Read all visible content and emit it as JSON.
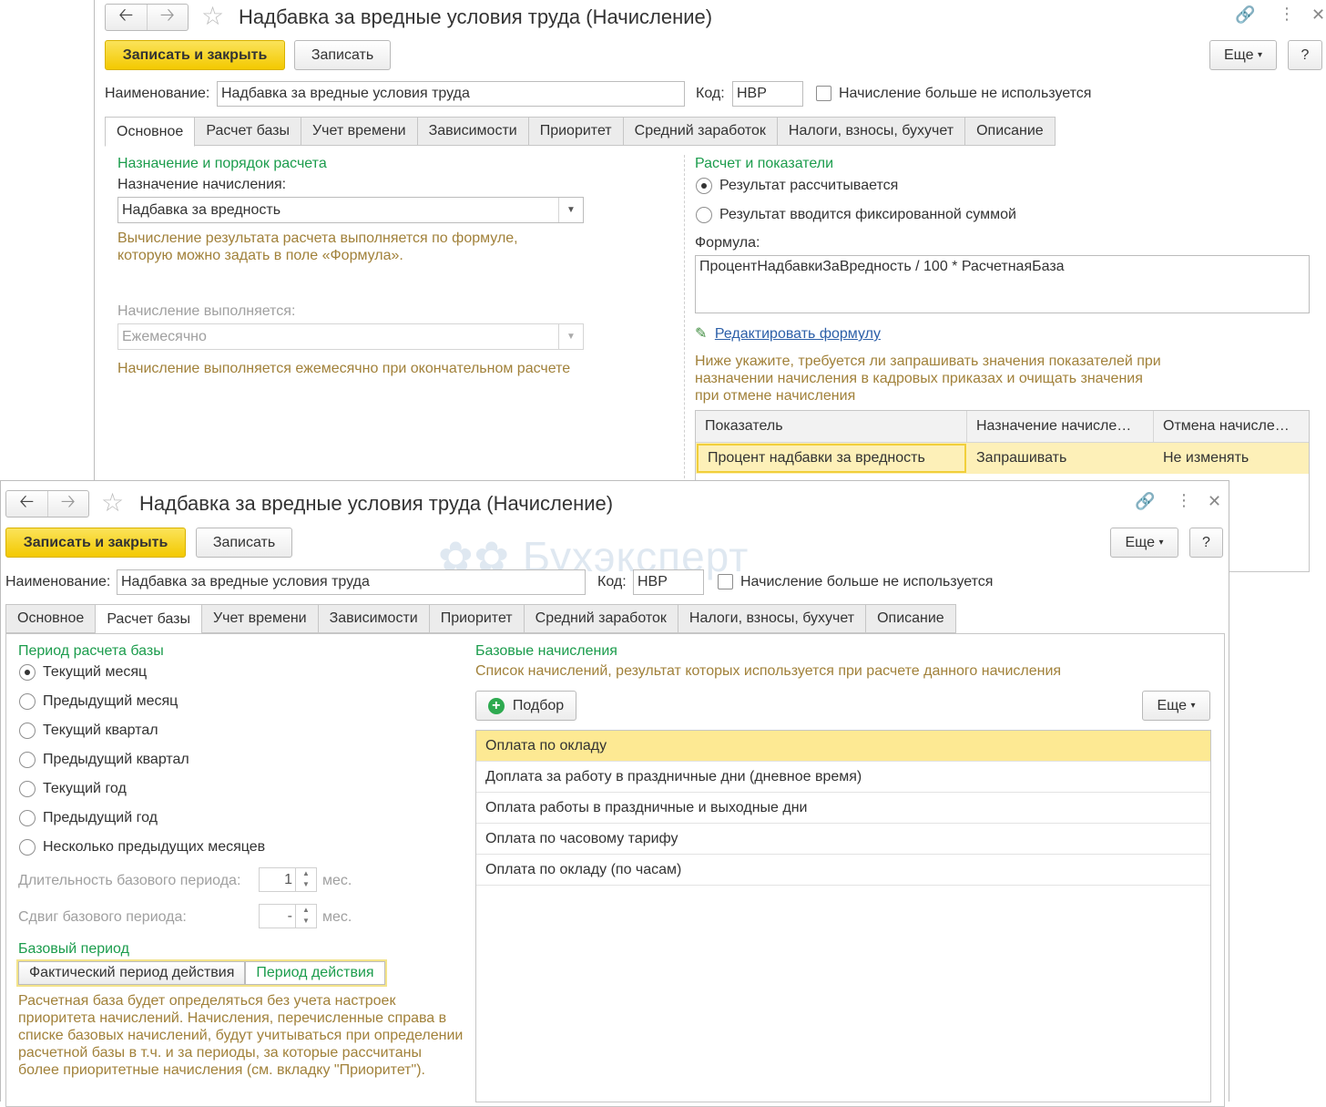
{
  "back_window": {
    "title": "Надбавка за вредные условия труда (Начисление)",
    "btn_save_close": "Записать и закрыть",
    "btn_save": "Записать",
    "btn_more": "Еще",
    "btn_help": "?",
    "name_label": "Наименование:",
    "name_value": "Надбавка за вредные условия труда",
    "code_label": "Код:",
    "code_value": "НВР",
    "unused_label": "Начисление больше не используется",
    "tabs": [
      "Основное",
      "Расчет базы",
      "Учет времени",
      "Зависимости",
      "Приоритет",
      "Средний заработок",
      "Налоги, взносы, бухучет",
      "Описание"
    ],
    "left": {
      "section": "Назначение и порядок расчета",
      "purpose_label": "Назначение начисления:",
      "purpose_value": "Надбавка за вредность",
      "purpose_hint": "Вычисление результата расчета выполняется по формуле, которую можно задать в поле «Формула».",
      "exec_label": "Начисление выполняется:",
      "exec_value": "Ежемесячно",
      "exec_hint": "Начисление выполняется ежемесячно при окончательном расчете"
    },
    "right": {
      "section": "Расчет и показатели",
      "radio_calc": "Результат рассчитывается",
      "radio_fixed": "Результат вводится фиксированной суммой",
      "formula_label": "Формула:",
      "formula_value": "ПроцентНадбавкиЗаВредность / 100 * РасчетнаяБаза",
      "edit_link": "Редактировать формулу",
      "indicators_hint": "Ниже укажите, требуется ли запрашивать значения показателей при назначении начисления в кадровых приказах и очищать значения при отмене начисления",
      "grid_headers": [
        "Показатель",
        "Назначение начисле…",
        "Отмена начисле…"
      ],
      "grid_row": [
        "Процент надбавки за вредность",
        "Запрашивать",
        "Не изменять"
      ]
    }
  },
  "front_window": {
    "title": "Надбавка за вредные условия труда (Начисление)",
    "btn_save_close": "Записать и закрыть",
    "btn_save": "Записать",
    "btn_more": "Еще",
    "btn_help": "?",
    "watermark": "Бухэксперт",
    "name_label": "Наименование:",
    "name_value": "Надбавка за вредные условия труда",
    "code_label": "Код:",
    "code_value": "НВР",
    "unused_label": "Начисление больше не используется",
    "tabs": [
      "Основное",
      "Расчет базы",
      "Учет времени",
      "Зависимости",
      "Приоритет",
      "Средний заработок",
      "Налоги, взносы, бухучет",
      "Описание"
    ],
    "left": {
      "section": "Период расчета базы",
      "periods": [
        "Текущий месяц",
        "Предыдущий месяц",
        "Текущий квартал",
        "Предыдущий квартал",
        "Текущий год",
        "Предыдущий год",
        "Несколько предыдущих месяцев"
      ],
      "duration_label": "Длительность базового периода:",
      "duration_value": "1",
      "duration_unit": "мес.",
      "shift_label": "Сдвиг базового периода:",
      "shift_value": "-",
      "shift_unit": "мес.",
      "base_section": "Базовый период",
      "seg_actual": "Фактический период действия",
      "seg_period": "Период действия",
      "base_hint": "Расчетная база будет определяться без учета настроек приоритета начислений. Начисления, перечисленные справа в списке базовых начислений, будут учитываться при определении расчетной базы в т.ч. и за периоды, за которые рассчитаны более приоритетные начисления (см. вкладку \"Приоритет\")."
    },
    "right": {
      "section": "Базовые начисления",
      "subtitle": "Список начислений, результат которых используется при расчете данного начисления",
      "btn_pick": "Подбор",
      "btn_more": "Еще",
      "items": [
        "Оплата по окладу",
        "Доплата за работу в праздничные дни (дневное время)",
        "Оплата работы в праздничные и выходные дни",
        "Оплата по часовому тарифу",
        "Оплата по окладу (по часам)"
      ]
    }
  }
}
